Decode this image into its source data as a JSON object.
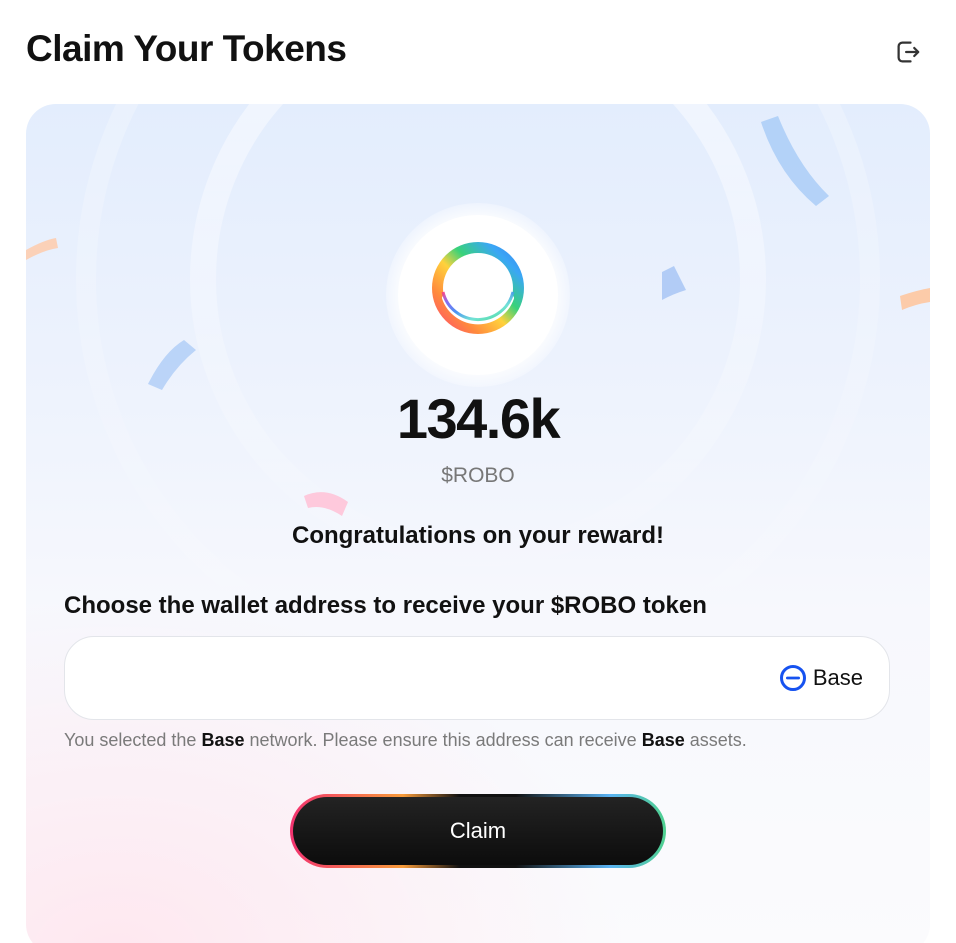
{
  "header": {
    "title": "Claim Your Tokens",
    "logout_icon": "logout-icon"
  },
  "reward": {
    "token_icon": "robo-ring-logo",
    "amount": "134.6k",
    "symbol": "$ROBO",
    "message": "Congratulations on your reward!"
  },
  "wallet": {
    "label": "Choose the wallet address to receive your $ROBO token",
    "input_value": "",
    "input_placeholder": "",
    "network": {
      "name": "Base",
      "icon": "base-network-icon",
      "color": "#1652f0"
    },
    "note": {
      "prefix": "You selected the ",
      "network_1": "Base",
      "middle": " network. Please ensure this address can receive ",
      "network_2": "Base",
      "suffix": " assets."
    }
  },
  "actions": {
    "claim_label": "Claim"
  },
  "colors": {
    "accent_blue": "#1652f0",
    "button_dark": "#111111",
    "muted_text": "#7a7a7a"
  }
}
